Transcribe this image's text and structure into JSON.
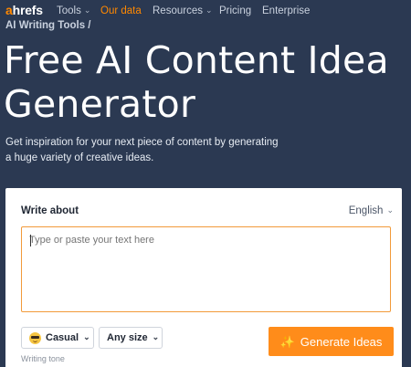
{
  "nav": {
    "logo_first": "a",
    "logo_rest": "hrefs",
    "items": [
      {
        "label": "Tools",
        "has_dropdown": true
      },
      {
        "label": "Our data",
        "has_dropdown": false,
        "active": true
      },
      {
        "label": "Resources",
        "has_dropdown": true
      },
      {
        "label": "Pricing",
        "has_dropdown": false
      },
      {
        "label": "Enterprise",
        "has_dropdown": false
      }
    ]
  },
  "breadcrumb": "AI Writing Tools /",
  "hero": {
    "title_line1": "Free AI Content Idea",
    "title_line2": "Generator",
    "subtitle": "Get inspiration for your next piece of content by generating a huge variety of creative ideas."
  },
  "form": {
    "write_label": "Write about",
    "language": "English",
    "textarea_placeholder": "Type or paste your text here",
    "tone_value": "Casual",
    "tone_caption": "Writing tone",
    "size_value": "Any size",
    "generate_label": "Generate Ideas"
  },
  "icons": {
    "dropdown": "chevron-down-icon",
    "tone": "sunglasses-emoji-icon",
    "generate": "sparkles-icon"
  },
  "colors": {
    "background": "#2b3952",
    "accent": "#ff8c1a",
    "textarea_border": "#f29a3a"
  }
}
